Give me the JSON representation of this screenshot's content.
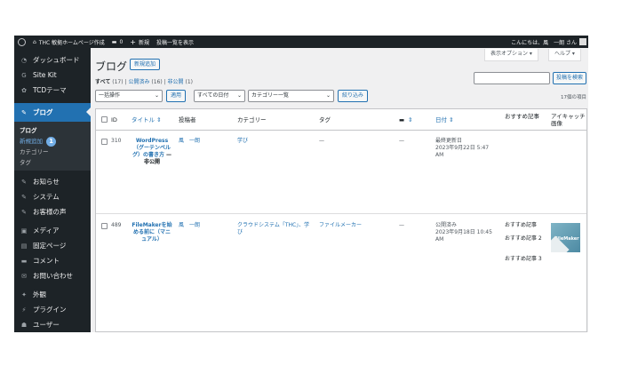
{
  "admin_bar": {
    "site_name": "THC 敏拠ホームページ作成",
    "comments_count": "0",
    "new_label": "新規",
    "view_posts": "投稿一覧を表示",
    "greeting": "こんにちは、風　一朗 さん"
  },
  "sidebar": {
    "items_top": [
      {
        "icon": "dashboard-icon",
        "glyph": "◔",
        "label": "ダッシュボード"
      },
      {
        "icon": "sitekit-icon",
        "glyph": "G",
        "label": "Site Kit"
      },
      {
        "icon": "theme-icon",
        "glyph": "✿",
        "label": "TCDテーマ"
      }
    ],
    "active": {
      "icon": "pin-icon",
      "glyph": "✎",
      "label": "ブログ"
    },
    "submenu": {
      "head": "ブログ",
      "current": "新規追加",
      "badge": "1",
      "items": [
        "カテゴリー",
        "タグ"
      ]
    },
    "items_bottom": [
      {
        "icon": "pin-icon",
        "glyph": "✎",
        "label": "お知らせ"
      },
      {
        "icon": "pin-icon",
        "glyph": "✎",
        "label": "システム"
      },
      {
        "icon": "pin-icon",
        "glyph": "✎",
        "label": "お客様の声"
      },
      {
        "icon": "media-icon",
        "glyph": "▣",
        "label": "メディア"
      },
      {
        "icon": "page-icon",
        "glyph": "▤",
        "label": "固定ページ"
      },
      {
        "icon": "comment-icon",
        "glyph": "▬",
        "label": "コメント"
      },
      {
        "icon": "mail-icon",
        "glyph": "✉",
        "label": "お問い合わせ"
      },
      {
        "icon": "appearance-icon",
        "glyph": "✦",
        "label": "外観"
      },
      {
        "icon": "plugin-icon",
        "glyph": "⚡",
        "label": "プラグイン"
      },
      {
        "icon": "user-icon",
        "glyph": "☗",
        "label": "ユーザー"
      }
    ]
  },
  "screen_options": "表示オプション ▾",
  "help": "ヘルプ ▾",
  "page_title": "ブログ",
  "add_new": "新規追加",
  "views": {
    "all": "すべて",
    "all_count": "(17)",
    "published": "公開済み",
    "published_count": "(16)",
    "private": "非公開",
    "private_count": "(1)"
  },
  "search_button": "投稿を検索",
  "bulk_action": "一括操作",
  "apply": "適用",
  "date_filter": "すべての日付",
  "category_filter": "カテゴリー一覧",
  "filter_button": "絞り込み",
  "items_count": "17個の項目",
  "table": {
    "headers": {
      "id": "ID",
      "title": "タイトル ⇕",
      "author": "投稿者",
      "category": "カテゴリー",
      "tags": "タグ",
      "comments": "⇕",
      "date": "日付 ⇕",
      "recommend": "おすすめ記事",
      "thumb": "アイキャッチ画像"
    },
    "rows": [
      {
        "id": "310",
        "title": "WordPress（グーテンベルグ）の書き方",
        "status": "— 非公開",
        "author": "風　一朗",
        "category": "学び",
        "tags": "—",
        "comments": "—",
        "date_label": "最終更新日",
        "date": "2023年9月22日 5:47 AM",
        "recommend": [],
        "thumb": ""
      },
      {
        "id": "489",
        "title": "FileMakerを始める前に（マニュアル）",
        "status": "",
        "author": "風　一朗",
        "category": "クラウドシステム「THC」、学び",
        "tags": "ファイルメーカー",
        "comments": "—",
        "date_label": "公開済み",
        "date": "2023年9月18日 10:45 AM",
        "recommend": [
          "おすすめ記事",
          "おすすめ記事 2",
          "おすすめ記事 3"
        ],
        "thumb": "FileMaker"
      }
    ]
  }
}
